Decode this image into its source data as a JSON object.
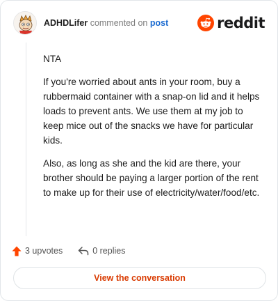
{
  "header": {
    "author": "ADHDLifer",
    "commented_on": "commented on",
    "post_link": "post",
    "brand": "reddit"
  },
  "comment": {
    "paragraphs": [
      "NTA",
      "If you're worried about ants in your room, buy a rubbermaid container with a snap-on lid and it helps loads to prevent ants. We use them at my job to keep mice out of the snacks we have for particular kids.",
      "Also, as long as she and the kid are there, your brother should be paying a larger portion of the rent to make up for their use of electricity/water/food/etc."
    ]
  },
  "actions": {
    "upvotes": "3 upvotes",
    "replies": "0 replies"
  },
  "cta": {
    "label": "View the conversation"
  },
  "colors": {
    "accent": "#d93a00",
    "link": "#1b6bd1",
    "upvote": "#ff4500"
  },
  "icons": {
    "avatar": "avatar-illustration",
    "brand": "reddit-logo-icon",
    "upvote": "upvote-arrow-icon",
    "reply": "reply-arrow-icon"
  }
}
